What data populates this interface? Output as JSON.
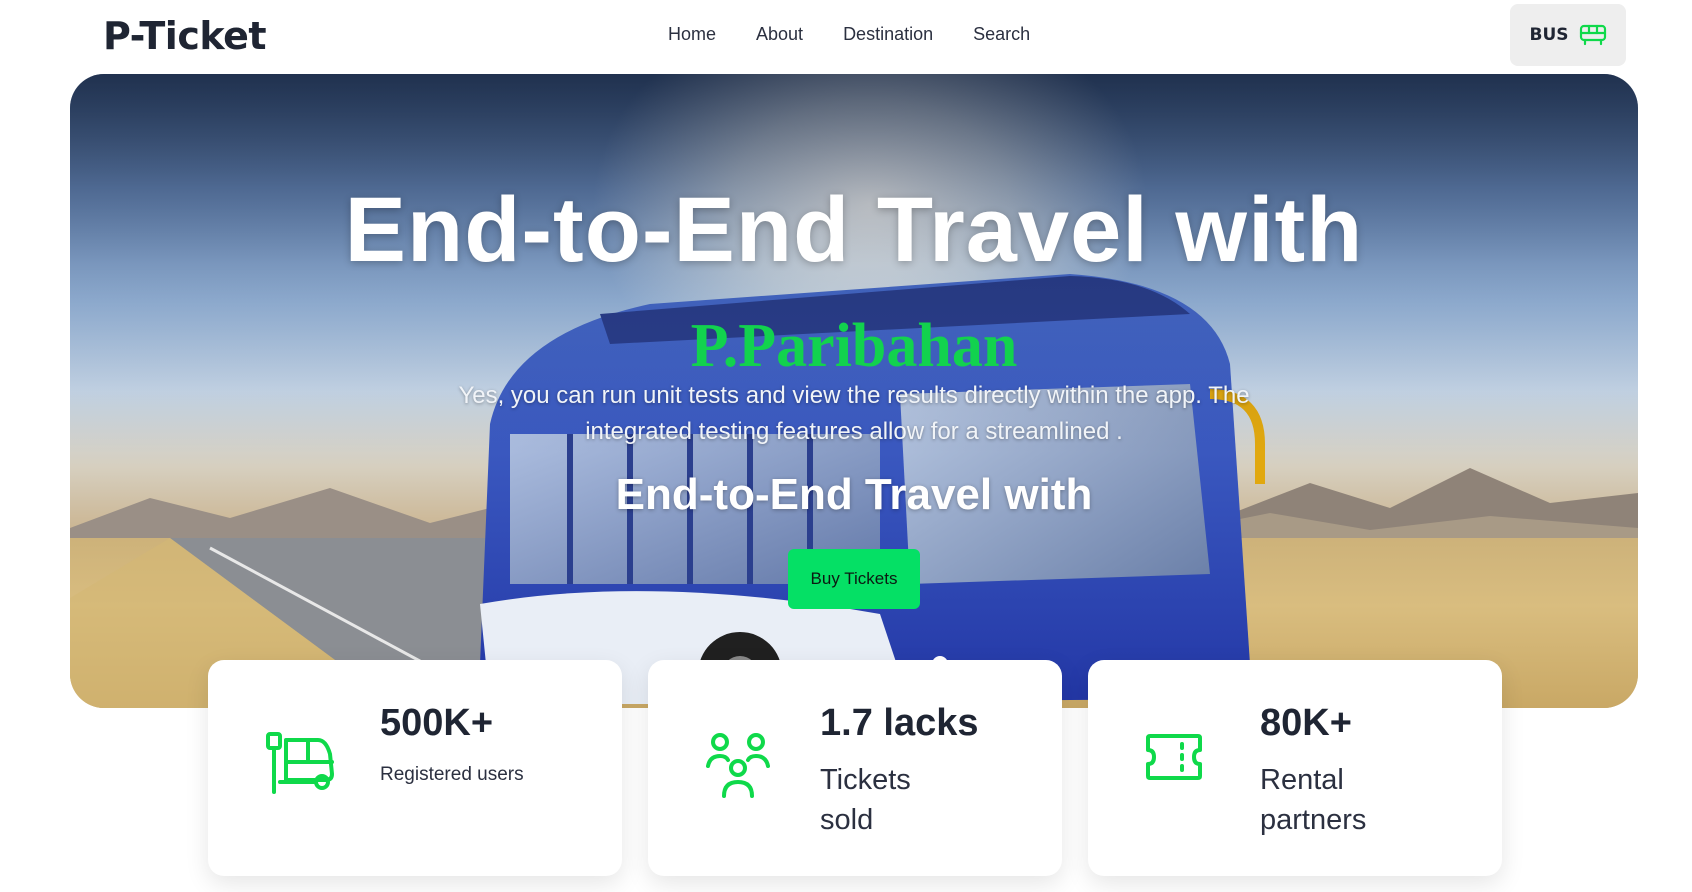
{
  "navbar": {
    "logo": "P-Ticket",
    "links": [
      {
        "label": "Home"
      },
      {
        "label": "About"
      },
      {
        "label": "Destination"
      },
      {
        "label": "Search"
      }
    ],
    "bus_button": {
      "label": "BUS",
      "icon": "bus-icon"
    }
  },
  "hero": {
    "title": "End-to-End Travel with",
    "brand": "P.Paribahan",
    "description": "Yes, you can run unit tests and view the results directly within the app. The integrated testing features allow for a streamlined .",
    "subtitle": "End-to-End Travel with",
    "cta_label": "Buy Tickets"
  },
  "stats": [
    {
      "value": "500K+",
      "label": "Registered users",
      "icon": "bus-stop-icon"
    },
    {
      "value": "1.7 lacks",
      "label": "Tickets sold",
      "icon": "users-group-icon"
    },
    {
      "value": "80K+",
      "label": "Rental partners",
      "icon": "ticket-icon"
    }
  ],
  "colors": {
    "accent_green": "#05e065",
    "brand_green": "#12d24e",
    "icon_green": "#0fd94a",
    "text_dark": "#1f2533"
  }
}
